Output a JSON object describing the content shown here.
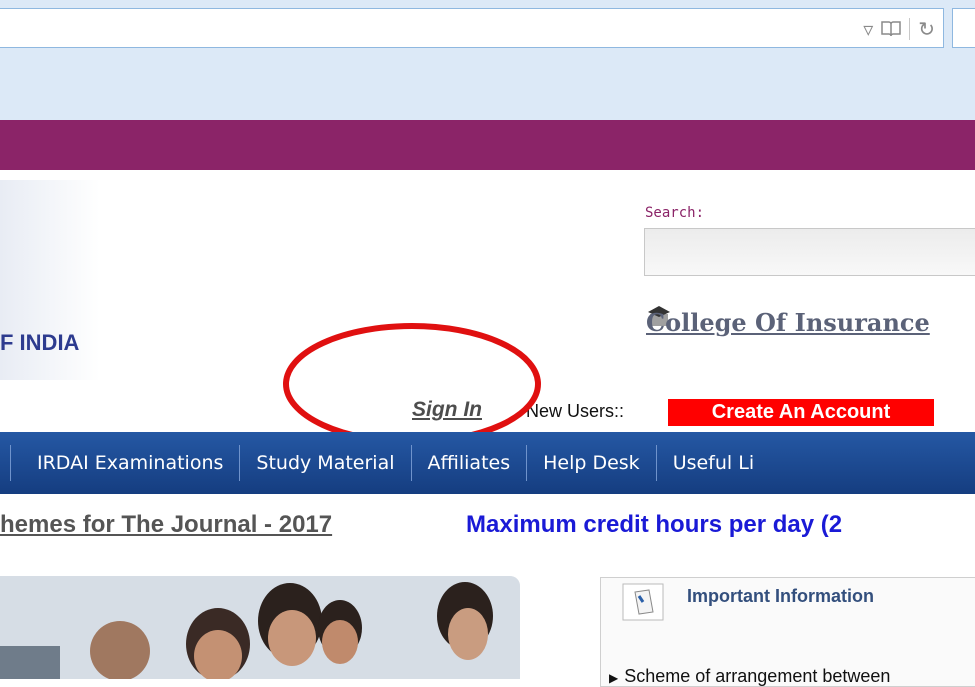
{
  "browser": {
    "address_value": "",
    "icons": [
      "dropdown-arrow-icon",
      "reading-view-icon",
      "refresh-icon"
    ]
  },
  "header": {
    "org_fragment": "F INDIA",
    "search": {
      "label": "Search:",
      "value": ""
    },
    "college_link": "College Of Insurance",
    "sign_in": "Sign In",
    "new_users": "New Users::",
    "create_account": "Create An Account"
  },
  "nav": {
    "items": [
      {
        "label": "IRDAI Examinations"
      },
      {
        "label": "Study Material"
      },
      {
        "label": "Affiliates"
      },
      {
        "label": "Help Desk"
      },
      {
        "label": "Useful Li"
      }
    ]
  },
  "content": {
    "news_link": "hemes for The Journal - 2017",
    "news_highlight": "Maximum credit hours per day (2",
    "info_box": {
      "title": "Important Information",
      "items": [
        "Scheme of arrangement between"
      ]
    }
  },
  "colors": {
    "brand_purple": "#8b2468",
    "nav_blue": "#1f4f9c",
    "accent_red": "#ff0000",
    "annotation_red": "#e01010"
  }
}
